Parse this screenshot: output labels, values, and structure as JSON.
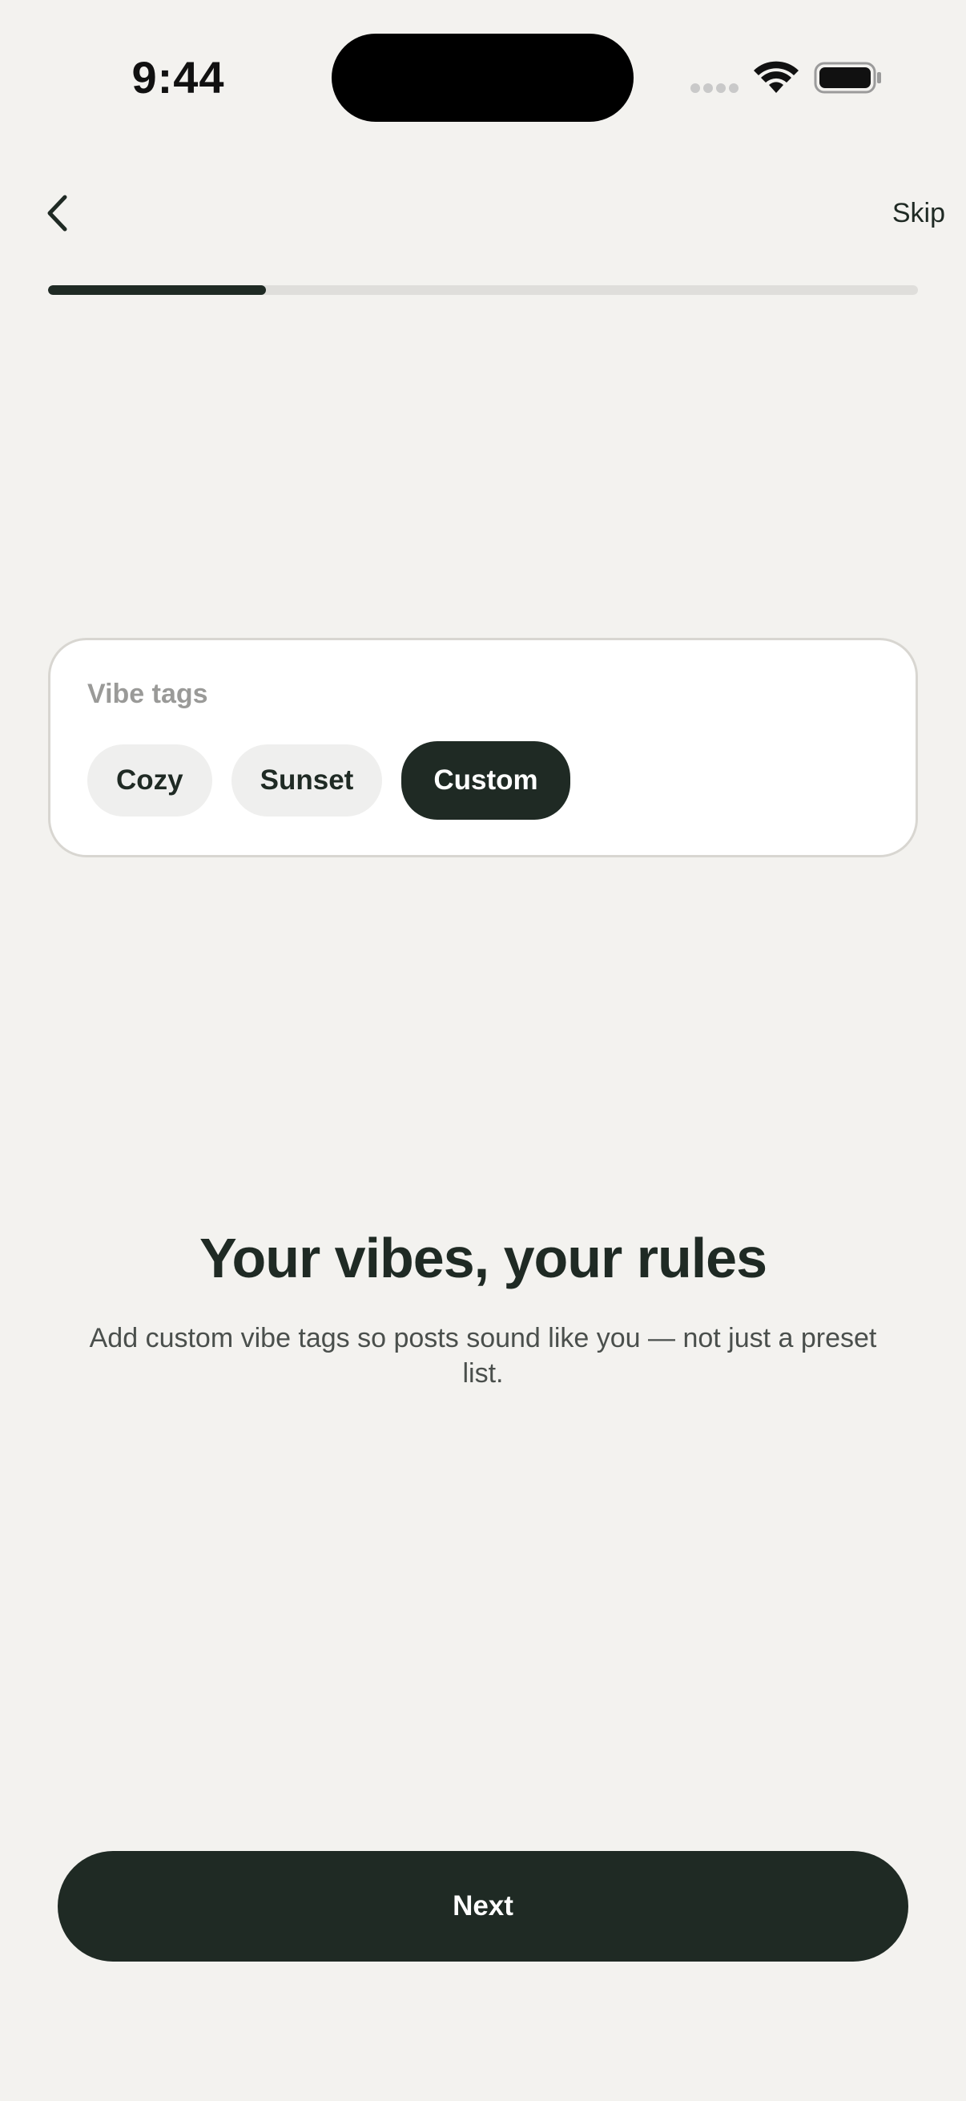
{
  "status_bar": {
    "time": "9:44"
  },
  "nav": {
    "back_icon": "chevron-left-icon",
    "skip_label": "Skip"
  },
  "progress": {
    "fraction": 0.25
  },
  "vibe_card": {
    "title": "Vibe tags",
    "chips": [
      {
        "label": "Cozy",
        "selected": false
      },
      {
        "label": "Sunset",
        "selected": false
      },
      {
        "label": "Custom",
        "selected": true
      }
    ]
  },
  "content": {
    "headline": "Your vibes, your rules",
    "subtext": "Add custom vibe tags so posts sound like you — not just a preset list."
  },
  "footer": {
    "next_label": "Next"
  },
  "colors": {
    "background": "#f3f2ef",
    "accent_dark": "#1f2a24",
    "chip_bg": "#efefee",
    "track": "#dfdedb"
  }
}
